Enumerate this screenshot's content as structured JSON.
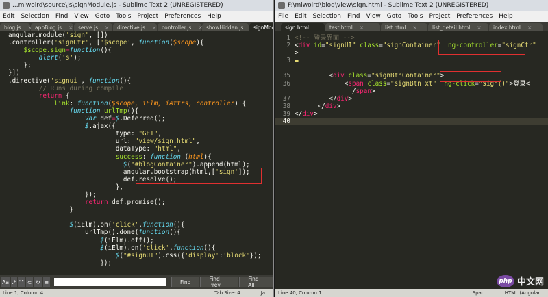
{
  "left": {
    "title": "...miwolrd\\source\\js\\signModule.js - Sublime Text 2 (UNREGISTERED)",
    "menu": [
      "Edit",
      "Selection",
      "Find",
      "View",
      "Goto",
      "Tools",
      "Project",
      "Preferences",
      "Help"
    ],
    "tabs": [
      "blog.js",
      "appBlog.js",
      "serve.js",
      "directive.js",
      "controller.js",
      "showHidden.js",
      "signModule.js"
    ],
    "status": {
      "position": "Line 1, Column 4",
      "tab_size": "Tab Size: 4",
      "syntax": "Ja"
    },
    "find": {
      "regex_btn": "Aa",
      "opt2": "\"\"",
      "find_label": "Find",
      "find_prev_label": "Find Prev",
      "find_all_label": "Find All"
    }
  },
  "right": {
    "title": "F:\\miwolrd\\blog\\view\\sign.html - Sublime Text 2 (UNREGISTERED)",
    "menu": [
      "File",
      "Edit",
      "Selection",
      "Find",
      "View",
      "Goto",
      "Tools",
      "Project",
      "Preferences",
      "Help"
    ],
    "tabs": [
      "sign.html",
      "test.html",
      "list.html",
      "list_detail.html",
      "index.html"
    ],
    "status": {
      "position": "Line 40, Column 1",
      "spaces": "Spac",
      "syntax": "HTML (Angular..."
    }
  },
  "watermark": {
    "logo": "php",
    "text": "中文网"
  }
}
